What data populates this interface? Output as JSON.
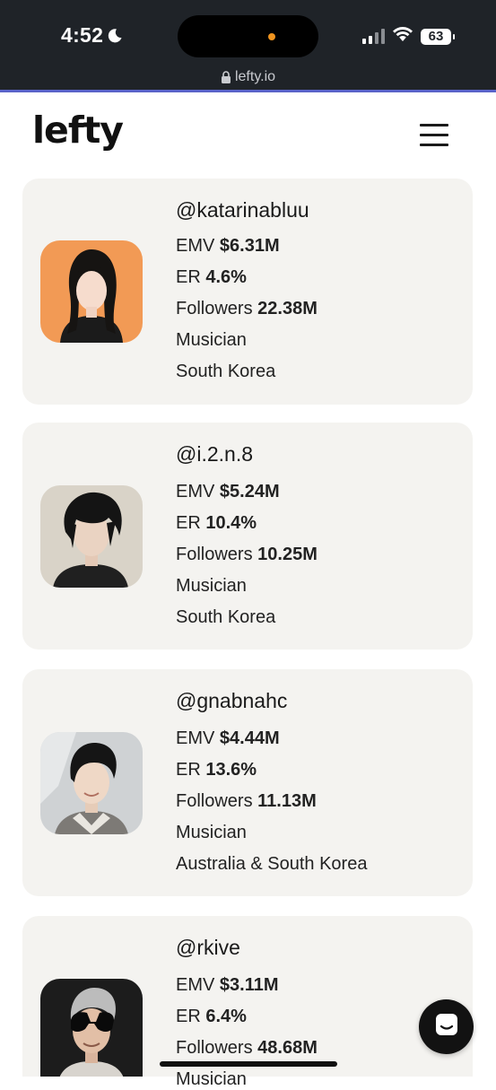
{
  "status_bar": {
    "time": "4:52",
    "battery": "63"
  },
  "browser": {
    "url": "lefty.io"
  },
  "header": {
    "logo": "lefty"
  },
  "influencers": [
    {
      "handle": "@katarinabluu",
      "emv_label": "EMV",
      "emv": "$6.31M",
      "er_label": "ER",
      "er": "4.6%",
      "followers_label": "Followers",
      "followers": "22.38M",
      "category": "Musician",
      "country": "South Korea",
      "avatar_bg": "#f29a55"
    },
    {
      "handle": "@i.2.n.8",
      "emv_label": "EMV",
      "emv": "$5.24M",
      "er_label": "ER",
      "er": "10.4%",
      "followers_label": "Followers",
      "followers": "10.25M",
      "category": "Musician",
      "country": "South Korea",
      "avatar_bg": "#d9d3c8"
    },
    {
      "handle": "@gnabnahc",
      "emv_label": "EMV",
      "emv": "$4.44M",
      "er_label": "ER",
      "er": "13.6%",
      "followers_label": "Followers",
      "followers": "11.13M",
      "category": "Musician",
      "country": "Australia & South Korea",
      "avatar_bg": "#cfd2d4"
    },
    {
      "handle": "@rkive",
      "emv_label": "EMV",
      "emv": "$3.11M",
      "er_label": "ER",
      "er": "6.4%",
      "followers_label": "Followers",
      "followers": "48.68M",
      "category": "Musician",
      "country": "",
      "avatar_bg": "#1c1c1c"
    }
  ],
  "colors": {
    "status_bar_bg": "#1f2328",
    "accent": "#5a63c9",
    "card_bg": "#f4f3f0",
    "island_dot": "#f0941f"
  }
}
